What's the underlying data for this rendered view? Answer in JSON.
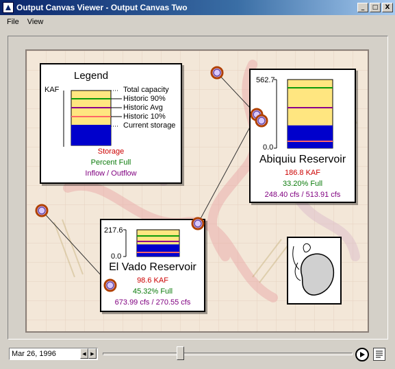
{
  "window": {
    "title": "Output Canvas Viewer - Output Canvas Two",
    "buttons": {
      "minimize": "_",
      "maximize": "□",
      "close": "X"
    }
  },
  "menu": [
    "File",
    "View"
  ],
  "legend": {
    "title": "Legend",
    "unit": "KAF",
    "items": [
      "Total capacity",
      "Historic 90%",
      "Historic Avg",
      "Historic 10%",
      "Current storage"
    ],
    "captions": {
      "storage": "Storage",
      "percent": "Percent Full",
      "flow": "Inflow / Outflow"
    }
  },
  "reservoirs": [
    {
      "name": "Abiquiu Reservoir",
      "axis_max": "562.7",
      "axis_min": "0.0",
      "storage": "186.8 KAF",
      "percent": "33.20% Full",
      "flows": "248.40 cfs / 513.91 cfs",
      "fill_fraction": 0.332
    },
    {
      "name": "El Vado Reservoir",
      "axis_max": "217.6",
      "axis_min": "0.0",
      "storage": "98.6 KAF",
      "percent": "45.32% Full",
      "flows": "673.99 cfs / 270.55 cfs",
      "fill_fraction": 0.4532
    }
  ],
  "colors": {
    "capacity": "#ffe680",
    "hist90": "#0a9a0a",
    "histavg": "#8b008b",
    "hist10": "#ff6666",
    "current": "#0000cc",
    "storage_text": "#cc0000",
    "percent_text": "#0a7a0a",
    "flow_text": "#800080"
  },
  "controls": {
    "date": "Mar 26, 1996",
    "play_icon": "play-icon",
    "log_icon": "log-icon"
  }
}
